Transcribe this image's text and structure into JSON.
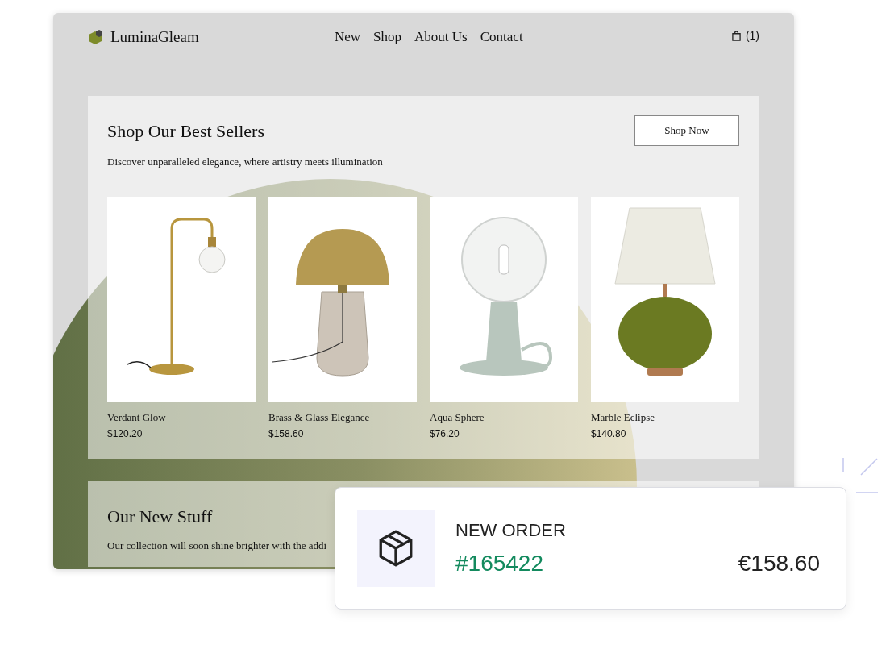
{
  "brand": "LuminaGleam",
  "nav": [
    {
      "label": "New"
    },
    {
      "label": "Shop"
    },
    {
      "label": "About Us"
    },
    {
      "label": "Contact"
    }
  ],
  "cart": {
    "count": "(1)"
  },
  "best_sellers": {
    "title": "Shop Our Best Sellers",
    "subtitle": "Discover unparalleled elegance, where artistry meets illumination",
    "button": "Shop Now",
    "products": [
      {
        "name": "Verdant Glow",
        "price": "$120.20",
        "kind": "arc"
      },
      {
        "name": "Brass & Glass Elegance",
        "price": "$158.60",
        "kind": "dome"
      },
      {
        "name": "Aqua Sphere",
        "price": "$76.20",
        "kind": "globe"
      },
      {
        "name": "Marble Eclipse",
        "price": "$140.80",
        "kind": "shade"
      }
    ]
  },
  "new_stuff": {
    "title": "Our New Stuff",
    "text": "Our collection will soon shine brighter with the addi"
  },
  "order_card": {
    "label": "NEW ORDER",
    "number": "#165422",
    "amount": "€158.60"
  }
}
